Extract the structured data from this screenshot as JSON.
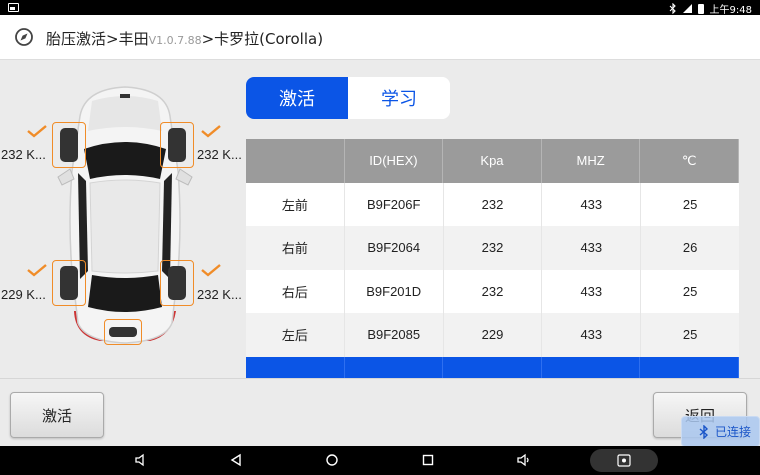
{
  "status_bar": {
    "time": "上午9:48",
    "icons": [
      "notification-icon",
      "bluetooth-icon",
      "wifi-signal-icon",
      "battery-icon"
    ]
  },
  "header": {
    "title_prefix": "胎压激活>丰田",
    "version": "V1.0.7.88",
    "title_suffix": ">卡罗拉(Corolla)",
    "icon": "compass-icon"
  },
  "car": {
    "tires": {
      "front_left": "232 K...",
      "front_right": "232 K...",
      "rear_left": "229 K...",
      "rear_right": "232 K..."
    },
    "highlight_color": "#f08c28"
  },
  "tabs": [
    {
      "label": "激活",
      "active": true
    },
    {
      "label": "学习",
      "active": false
    }
  ],
  "table": {
    "headers": [
      "",
      "ID(HEX)",
      "Kpa",
      "MHZ",
      "℃"
    ],
    "rows": [
      [
        "左前",
        "B9F206F",
        "232",
        "433",
        "25"
      ],
      [
        "右前",
        "B9F2064",
        "232",
        "433",
        "26"
      ],
      [
        "右后",
        "B9F201D",
        "232",
        "433",
        "25"
      ],
      [
        "左后",
        "B9F2085",
        "229",
        "433",
        "25"
      ]
    ]
  },
  "buttons": {
    "activate": "激活",
    "back": "返回"
  },
  "connection_badge": "已连接",
  "accent_color": "#0b55e6"
}
